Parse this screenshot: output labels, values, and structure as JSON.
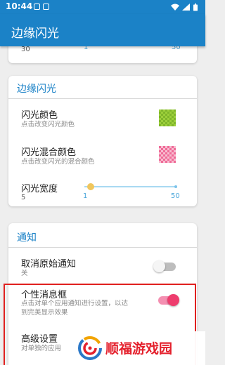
{
  "status_bar": {
    "time": "10:44"
  },
  "app_bar": {
    "title": "边缘闪光"
  },
  "top_card": {
    "value": "30",
    "slider_min": "1",
    "slider_max": "50"
  },
  "flash_card": {
    "title": "边缘闪光",
    "flash_color": {
      "label": "闪光颜色",
      "sub": "点击改变闪光颜色"
    },
    "mix_color": {
      "label": "闪光混合颜色",
      "sub": "点击改变闪光的混合颜色"
    },
    "width": {
      "label": "闪光宽度",
      "value": "5",
      "min": "1",
      "max": "50",
      "current": 5
    }
  },
  "notify_card": {
    "title": "通知",
    "cancel_original": {
      "label": "取消原始通知",
      "sub": "关",
      "checked": false
    },
    "personal_box": {
      "label": "个性消息框",
      "sub1": "点击对单个应用通知进行设置，以达",
      "sub2": "到完美显示效果",
      "checked": true
    },
    "advanced": {
      "label": "高级设置",
      "sub": "对单独的应用"
    }
  },
  "watermark": {
    "text": "顺福游戏园"
  },
  "colors": {
    "primary": "#1b82c7",
    "accent": "#ee3d6e",
    "highlight_box": "#e0201f",
    "watermark": "#e4202c"
  }
}
